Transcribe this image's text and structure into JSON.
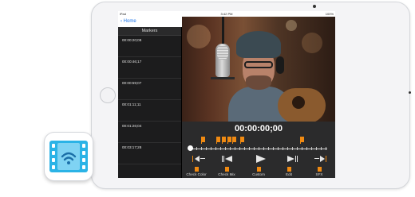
{
  "status_bar": {
    "carrier": "iPad",
    "time": "3:42 PM",
    "battery": "100%"
  },
  "nav": {
    "back_label": "Home"
  },
  "sidebar": {
    "title": "Markers",
    "markers": [
      "00:00:20;08",
      "00:00:46;17",
      "00:00:59;07",
      "00:01:11;11",
      "00:01:26;04",
      "00:03:17;28"
    ]
  },
  "player": {
    "timecode": "00:00:00;00"
  },
  "controls": {
    "buttons": [
      "Check Color",
      "Check Mix",
      "Custom",
      "Edit",
      "SFX"
    ]
  },
  "colors": {
    "accent": "#f08a12",
    "app_icon": "#2bb3e6"
  },
  "icons": {
    "app": "film-wifi-icon",
    "back": "chevron-left-icon"
  }
}
